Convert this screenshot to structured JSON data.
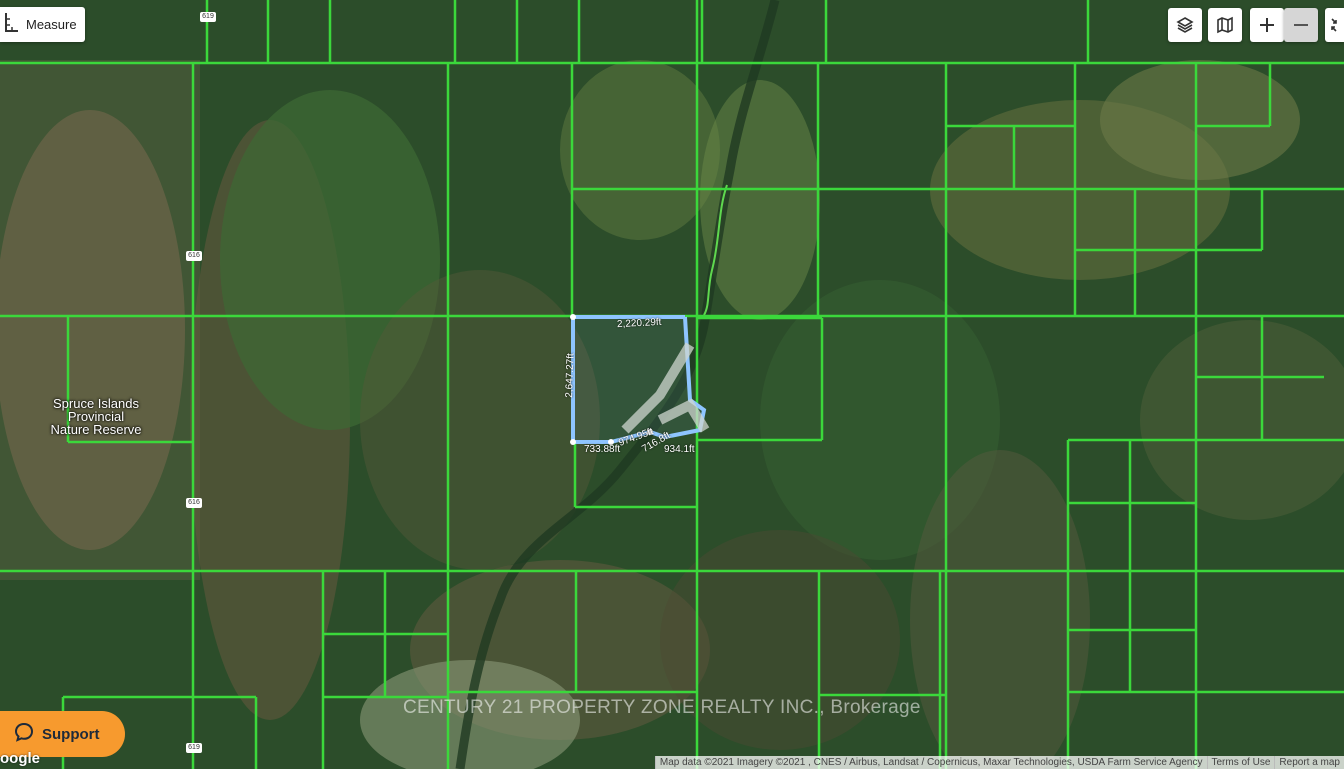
{
  "toolbar": {
    "measure_label": "Measure",
    "icons": [
      "ruler-icon",
      "layers-icon",
      "map-icon",
      "plus-icon",
      "minus-icon",
      "fullscreen-icon"
    ]
  },
  "map": {
    "place_label_lines": [
      "Spruce Islands",
      "Provincial",
      "Nature Reserve"
    ],
    "road_shields": [
      "619",
      "616",
      "616",
      "619"
    ],
    "measurements": [
      "2,220.29ft",
      "2,647.27ft",
      "733.88ft",
      "974.95ft",
      "716.8ft",
      "934.1ft"
    ],
    "watermark": "CENTURY 21 PROPERTY ZONE REALTY INC., Brokerage",
    "parcel_line_color": "#3bd83b",
    "measure_line_color": "#8ec5ff"
  },
  "support": {
    "label": "Support"
  },
  "attribution": {
    "map_data": "Map data ©2021 Imagery ©2021 , CNES / Airbus, Landsat / Copernicus, Maxar Technologies, USDA Farm Service Agency",
    "terms": "Terms of Use",
    "report": "Report a map"
  },
  "logo": "oogle"
}
